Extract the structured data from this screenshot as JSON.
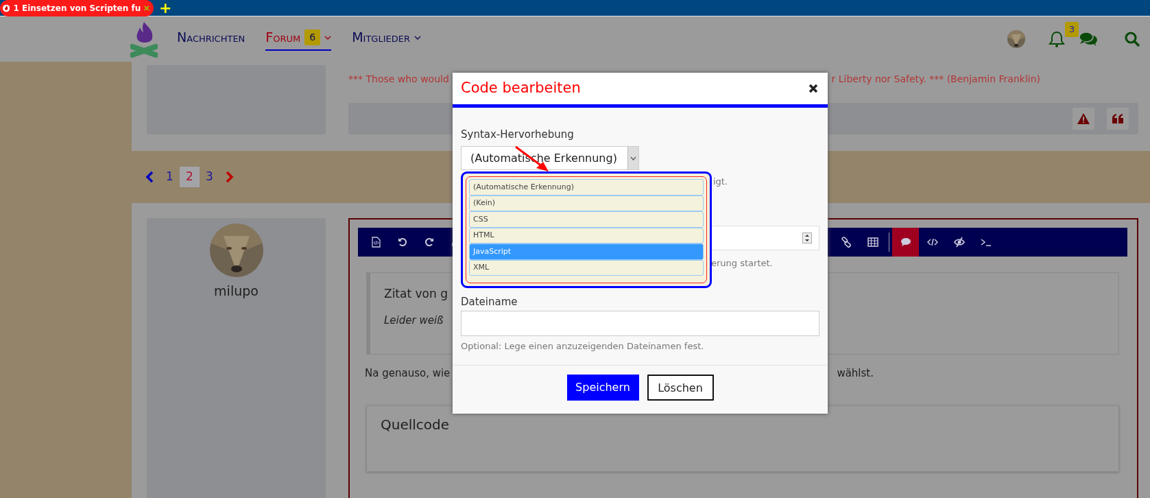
{
  "browser_tab": {
    "title": "1 Einsetzen von Scripten fu",
    "new_tab": "+"
  },
  "navbar": {
    "items": [
      {
        "label": "Nachrichten",
        "selected": false,
        "dropdown": false
      },
      {
        "label": "Forum",
        "selected": true,
        "badge": "6",
        "dropdown": true
      },
      {
        "label": "Mitglieder",
        "selected": false,
        "dropdown": true
      }
    ],
    "notifications_badge": "3"
  },
  "post": {
    "signature_parts": [
      "*** Those who would",
      "r Liberty nor Safety. *** (Benjamin Franklin)"
    ]
  },
  "pagination": {
    "pages": [
      {
        "label": "1",
        "selected": false
      },
      {
        "label": "2",
        "selected": true
      },
      {
        "label": "3",
        "selected": false
      }
    ]
  },
  "reply": {
    "author": "milupo",
    "quote_title": "Zitat von g",
    "quote_text": "Leider weiß",
    "text_parts": [
      "Na genauso, wie",
      "wählst."
    ],
    "code_box_title": "Quellcode",
    "toolbar": [
      {
        "selected": false
      },
      {
        "selected": false
      },
      {
        "selected": false
      },
      {
        "selected": false
      },
      {
        "selected": false
      },
      {
        "selected": false
      },
      {
        "selected": true
      },
      {
        "selected": false
      },
      {
        "selected": false
      },
      {
        "selected": false
      }
    ]
  },
  "modal": {
    "title": "Code bearbeiten",
    "syntax_label": "Syntax-Hervorhebung",
    "syntax_value": "(Automatische Erkennung)",
    "syntax_hint": "igt.",
    "line_hint": "erung startet.",
    "filename_label": "Dateiname",
    "filename_hint": "Optional: Lege einen anzuzeigenden Dateinamen fest.",
    "options": [
      {
        "label": "(Automatische Erkennung)",
        "selected": false
      },
      {
        "label": "(Kein)",
        "selected": false
      },
      {
        "label": "CSS",
        "selected": false
      },
      {
        "label": "HTML",
        "selected": false
      },
      {
        "label": "JavaScript",
        "selected": true
      },
      {
        "label": "XML",
        "selected": false
      }
    ],
    "buttons": [
      {
        "label": "Speichern",
        "kind": "primary"
      },
      {
        "label": "Löschen",
        "kind": "secondary"
      }
    ]
  }
}
